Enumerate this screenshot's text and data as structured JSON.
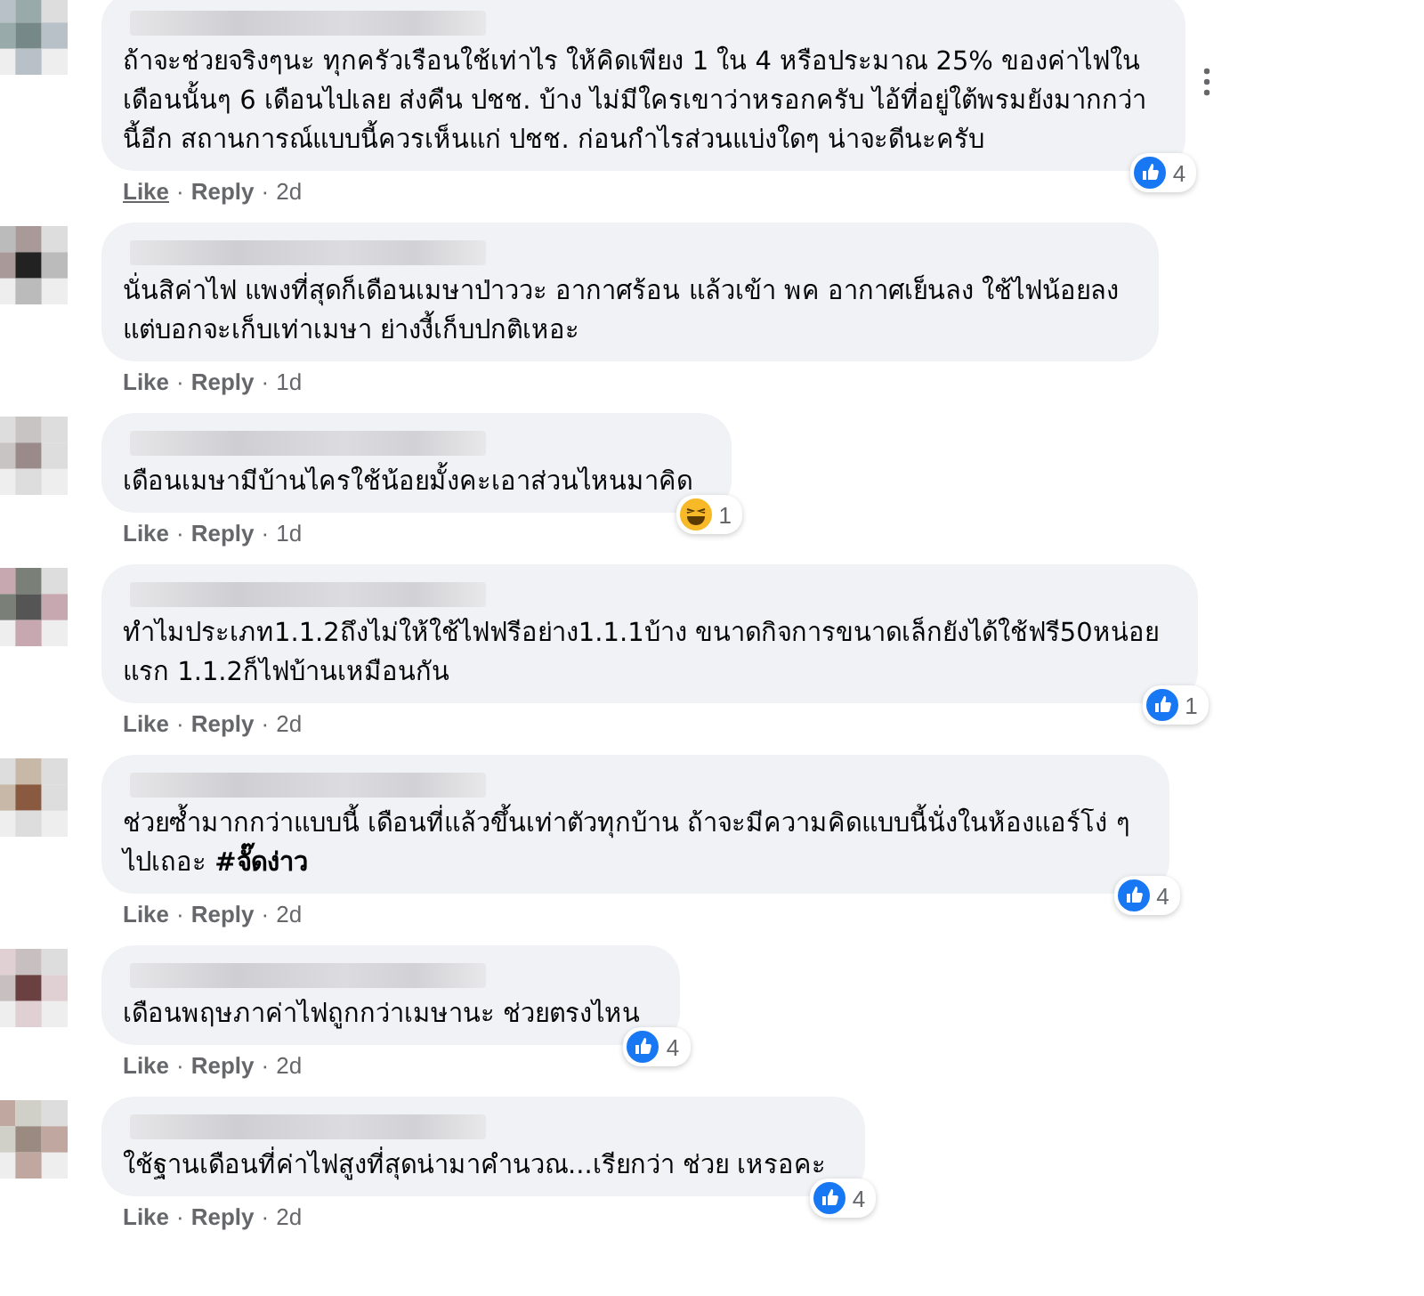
{
  "comments": [
    {
      "separator": "·",
      "text": "ถ้าจะช่วยจริงๆนะ ทุกครัวเรือนใช้เท่าไร ให้คิดเพียง 1 ใน 4 หรือประมาณ 25% ของค่าไฟใน\nเดือนนั้นๆ 6 เดือนไปเลย ส่งคืน ปชช. บ้าง ไม่มีใครเขาว่าหรอกครับ ไอ้ที่อยู่ใต้พรมยังมากกว่า\nนี้อีก สถานการณ์แบบนี้ควรเห็นแก่ ปชช. ก่อนกำไรส่วนแบ่งใดๆ น่าจะดีนะครับ",
      "like": "Like",
      "like_hovered": true,
      "reply": "Reply",
      "time": "2d",
      "more_button": true,
      "reaction": {
        "kind": "like",
        "count": "4"
      }
    },
    {
      "separator": "·",
      "text": "นั่นสิค่าไฟ แพงที่สุดก็เดือนเมษาป่าววะ อากาศร้อน แล้วเข้า พค อากาศเย็นลง ใช้ไฟน้อยลง\nแต่บอกจะเก็บเท่าเมษา ย่างงี้เก็บปกติเหอะ",
      "like": "Like",
      "like_hovered": false,
      "reply": "Reply",
      "time": "1d",
      "more_button": false
    },
    {
      "separator": "·",
      "text": "เดือนเมษามีบ้านไครใช้น้อยมั้งคะเอาส่วนไหนมาคิด",
      "like": "Like",
      "like_hovered": false,
      "reply": "Reply",
      "time": "1d",
      "more_button": false,
      "reaction": {
        "kind": "haha",
        "count": "1"
      }
    },
    {
      "separator": "·",
      "text": "ทำไมประเภท1.1.2ถึงไม่ให้ใช้ไฟฟรีอย่าง1.1.1บ้าง ขนาดกิจการขนาดเล็กยังได้ใช้ฟรี50หน่อย\nแรก 1.1.2ก็ไฟบ้านเหมือนกัน",
      "like": "Like",
      "like_hovered": false,
      "reply": "Reply",
      "time": "2d",
      "more_button": false,
      "reaction": {
        "kind": "like",
        "count": "1"
      }
    },
    {
      "separator": "·",
      "text": "ช่วยซ้ำมากกว่าแบบนี้ เดือนที่แล้วขึ้นเท่าตัวทุกบ้าน ถ้าจะมีความคิดแบบนี้นั่งในห้องแอร์โง่ ๆ\nไปเถอะ **#จั๊ดง่าว**",
      "like": "Like",
      "like_hovered": false,
      "reply": "Reply",
      "time": "2d",
      "more_button": false,
      "reaction": {
        "kind": "like",
        "count": "4"
      }
    },
    {
      "separator": "·",
      "text": "เดือนพฤษภาค่าไฟถูกกว่าเมษานะ ช่วยตรงไหน",
      "like": "Like",
      "like_hovered": false,
      "reply": "Reply",
      "time": "2d",
      "more_button": false,
      "reaction": {
        "kind": "like",
        "count": "4"
      }
    },
    {
      "separator": "·",
      "text": "ใช้ฐานเดือนที่ค่าไฟสูงที่สุดน่ามาคำนวณ...เรียกว่า ช่วย เหรอคะ",
      "like": "Like",
      "like_hovered": false,
      "reply": "Reply",
      "time": "2d",
      "more_button": false,
      "reaction": {
        "kind": "like",
        "count": "4"
      }
    }
  ]
}
